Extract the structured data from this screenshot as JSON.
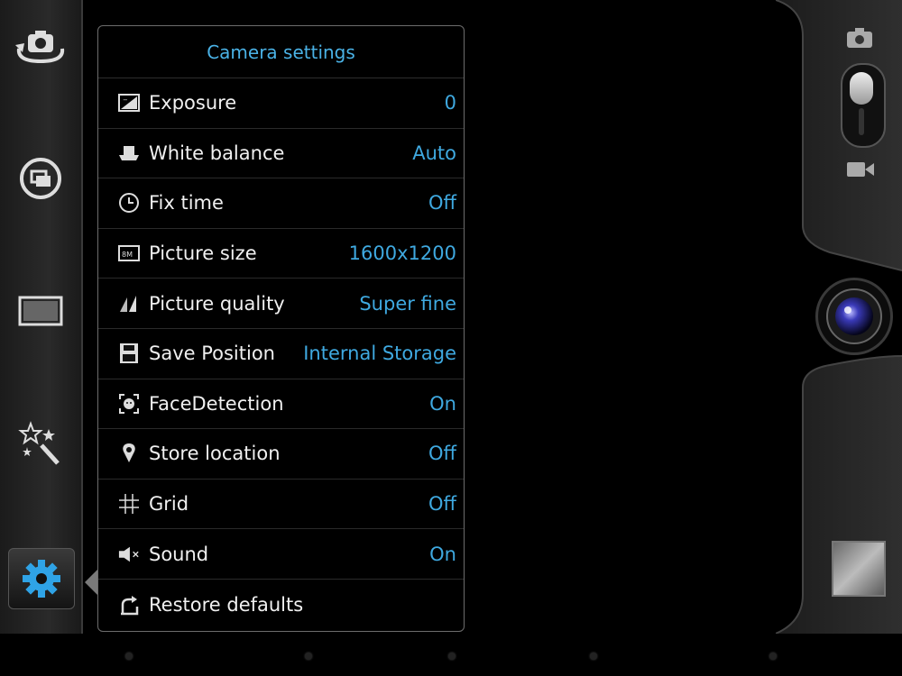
{
  "panel": {
    "title": "Camera settings",
    "rows": [
      {
        "label": "Exposure",
        "value": "0",
        "icon": "exposure-icon"
      },
      {
        "label": "White balance",
        "value": "Auto",
        "icon": "white-balance-icon"
      },
      {
        "label": "Fix time",
        "value": "Off",
        "icon": "clock-icon"
      },
      {
        "label": "Picture size",
        "value": "1600x1200",
        "icon": "picture-size-icon"
      },
      {
        "label": "Picture quality",
        "value": "Super fine",
        "icon": "picture-quality-icon"
      },
      {
        "label": "Save Position",
        "value": "Internal Storage",
        "icon": "storage-icon"
      },
      {
        "label": "FaceDetection",
        "value": "On",
        "icon": "face-detection-icon"
      },
      {
        "label": "Store location",
        "value": "Off",
        "icon": "location-pin-icon"
      },
      {
        "label": "Grid",
        "value": "Off",
        "icon": "grid-icon"
      },
      {
        "label": "Sound",
        "value": "On",
        "icon": "speaker-icon"
      },
      {
        "label": "Restore defaults",
        "value": "",
        "icon": "restore-icon"
      }
    ]
  },
  "rail": {
    "items": [
      "switch-camera-icon",
      "shooting-mode-icon",
      "aspect-ratio-icon",
      "effects-wand-icon",
      "settings-gear-icon"
    ]
  },
  "colors": {
    "accent": "#3fa9e0",
    "text": "#f0f0f0",
    "panel_border": "#6d6d6d"
  }
}
